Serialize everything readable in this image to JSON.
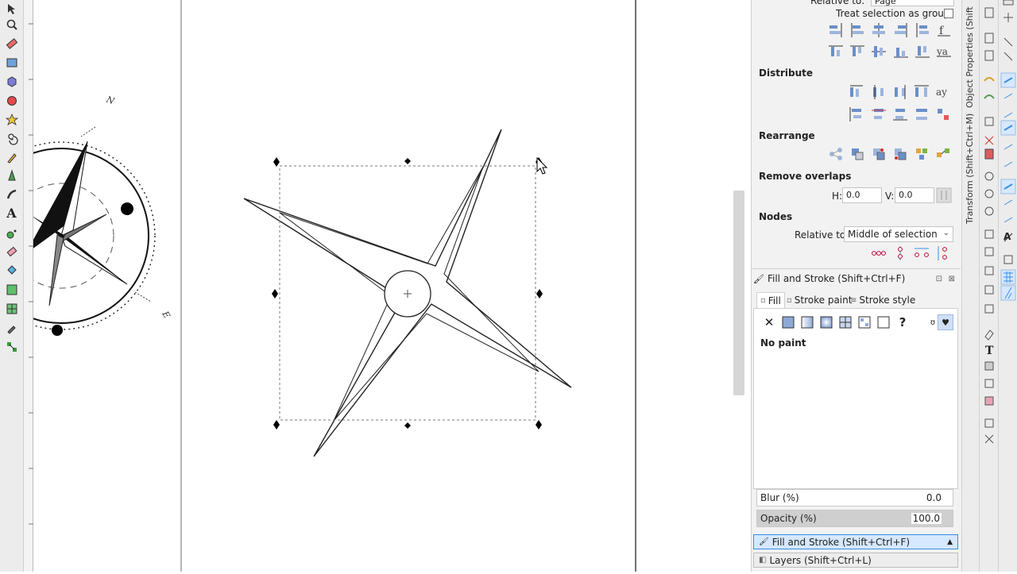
{
  "align": {
    "relative_to_label": "Relative to:",
    "relative_to_value": "Page",
    "treat_as_group_label": "Treat selection as group:"
  },
  "sections": {
    "distribute": "Distribute",
    "rearrange": "Rearrange",
    "remove_overlaps": "Remove overlaps",
    "nodes": "Nodes"
  },
  "overlaps": {
    "h_label": "H:",
    "h_value": "0.0",
    "v_label": "V:",
    "v_value": "0.0"
  },
  "nodes": {
    "relative_to_label": "Relative to:",
    "relative_to_value": "Middle of selection"
  },
  "fill_stroke": {
    "title": "Fill and Stroke (Shift+Ctrl+F)",
    "tabs": [
      "Fill",
      "Stroke paint",
      "Stroke style"
    ],
    "paint_status": "No paint",
    "blur_label": "Blur (%)",
    "blur_value": "0.0",
    "opacity_label": "Opacity (%)",
    "opacity_value": "100.0"
  },
  "docked": {
    "fill_stroke": "Fill and Stroke (Shift+Ctrl+F)",
    "layers": "Layers (Shift+Ctrl+L)"
  },
  "vertical_tabs": {
    "object_properties": "Object Properties (Shift",
    "transform": "Transform (Shift+Ctrl+M)"
  },
  "compass_labels": {
    "north": "N",
    "east": "E"
  },
  "colors": {
    "accent": "#3c8ee6",
    "selection": "#d6e8ff",
    "dock_bg": "#f2f2f2"
  }
}
